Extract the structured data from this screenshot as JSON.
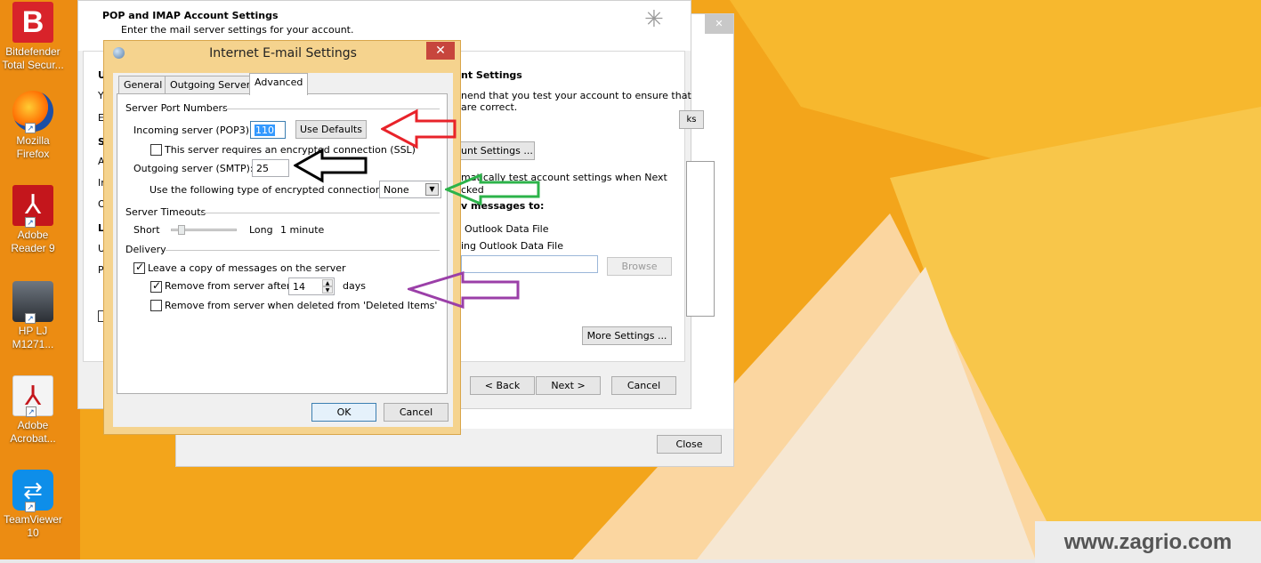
{
  "desktop": {
    "icons": [
      {
        "label_1": "Bitdefender",
        "label_2": "Total Secur...",
        "icon": "bitdefender-icon"
      },
      {
        "label_1": "Mozilla",
        "label_2": "Firefox",
        "icon": "firefox-icon"
      },
      {
        "label_1": "Adobe",
        "label_2": "Reader 9",
        "icon": "adobe-reader-icon"
      },
      {
        "label_1": "HP LJ",
        "label_2": "M1271...",
        "icon": "scanner-icon"
      },
      {
        "label_1": "Adobe",
        "label_2": "Acrobat...",
        "icon": "adobe-acrobat-icon"
      },
      {
        "label_1": "TeamViewer",
        "label_2": "10",
        "icon": "teamviewer-icon"
      }
    ]
  },
  "account_settings_window": {
    "close_label": "Close"
  },
  "wizard": {
    "title": "POP and IMAP Account Settings",
    "subtitle": "Enter the mail server settings for your account.",
    "test_heading": "nt Settings",
    "test_text_1": "nend that you test your account to ensure that",
    "test_text_2": "are correct.",
    "test_button": "unt Settings ...",
    "auto_test_1": "matically test account settings when Next",
    "auto_test_2": "cked",
    "deliver_heading": "v messages to:",
    "option_1": "Outlook Data File",
    "option_2": "ing Outlook Data File",
    "browse_label": "Browse",
    "more_settings_label": "More Settings ...",
    "back_label": "< Back",
    "next_label": "Next >",
    "cancel_label": "Cancel",
    "left_letters": [
      "U",
      "Y",
      "E",
      "S",
      "A",
      "Ir",
      "O",
      "L",
      "U",
      "P"
    ],
    "tabs_partial": "ks"
  },
  "dialog": {
    "title": "Internet E-mail Settings",
    "close_glyph": "✕",
    "tabs": [
      "General",
      "Outgoing Server",
      "Advanced"
    ],
    "active_tab": "Advanced",
    "server_ports": {
      "heading": "Server Port Numbers",
      "incoming_label": "Incoming server (POP3):",
      "incoming_value": "110",
      "use_defaults_label": "Use Defaults",
      "ssl_label": "This server requires an encrypted connection (SSL)",
      "ssl_checked": false,
      "outgoing_label": "Outgoing server (SMTP):",
      "outgoing_value": "25",
      "encryption_label": "Use the following type of encrypted connection:",
      "encryption_value": "None"
    },
    "timeouts": {
      "heading": "Server Timeouts",
      "short_label": "Short",
      "long_label": "Long",
      "value": "1 minute",
      "slider_level": 0.1
    },
    "delivery": {
      "heading": "Delivery",
      "leave_copy_label": "Leave a copy of messages on the server",
      "leave_copy_checked": true,
      "remove_after_label": "Remove from server after",
      "remove_after_checked": true,
      "remove_after_value": "14",
      "days_label": "days",
      "remove_deleted_label": "Remove from server when deleted from 'Deleted Items'",
      "remove_deleted_checked": false
    },
    "ok_label": "OK",
    "cancel_label": "Cancel"
  },
  "annotations": {
    "colors": {
      "red": "#e8232a",
      "black": "#000000",
      "green": "#2cb34a",
      "purple": "#9b3fa8"
    }
  },
  "watermark": "www.zagrio.com"
}
